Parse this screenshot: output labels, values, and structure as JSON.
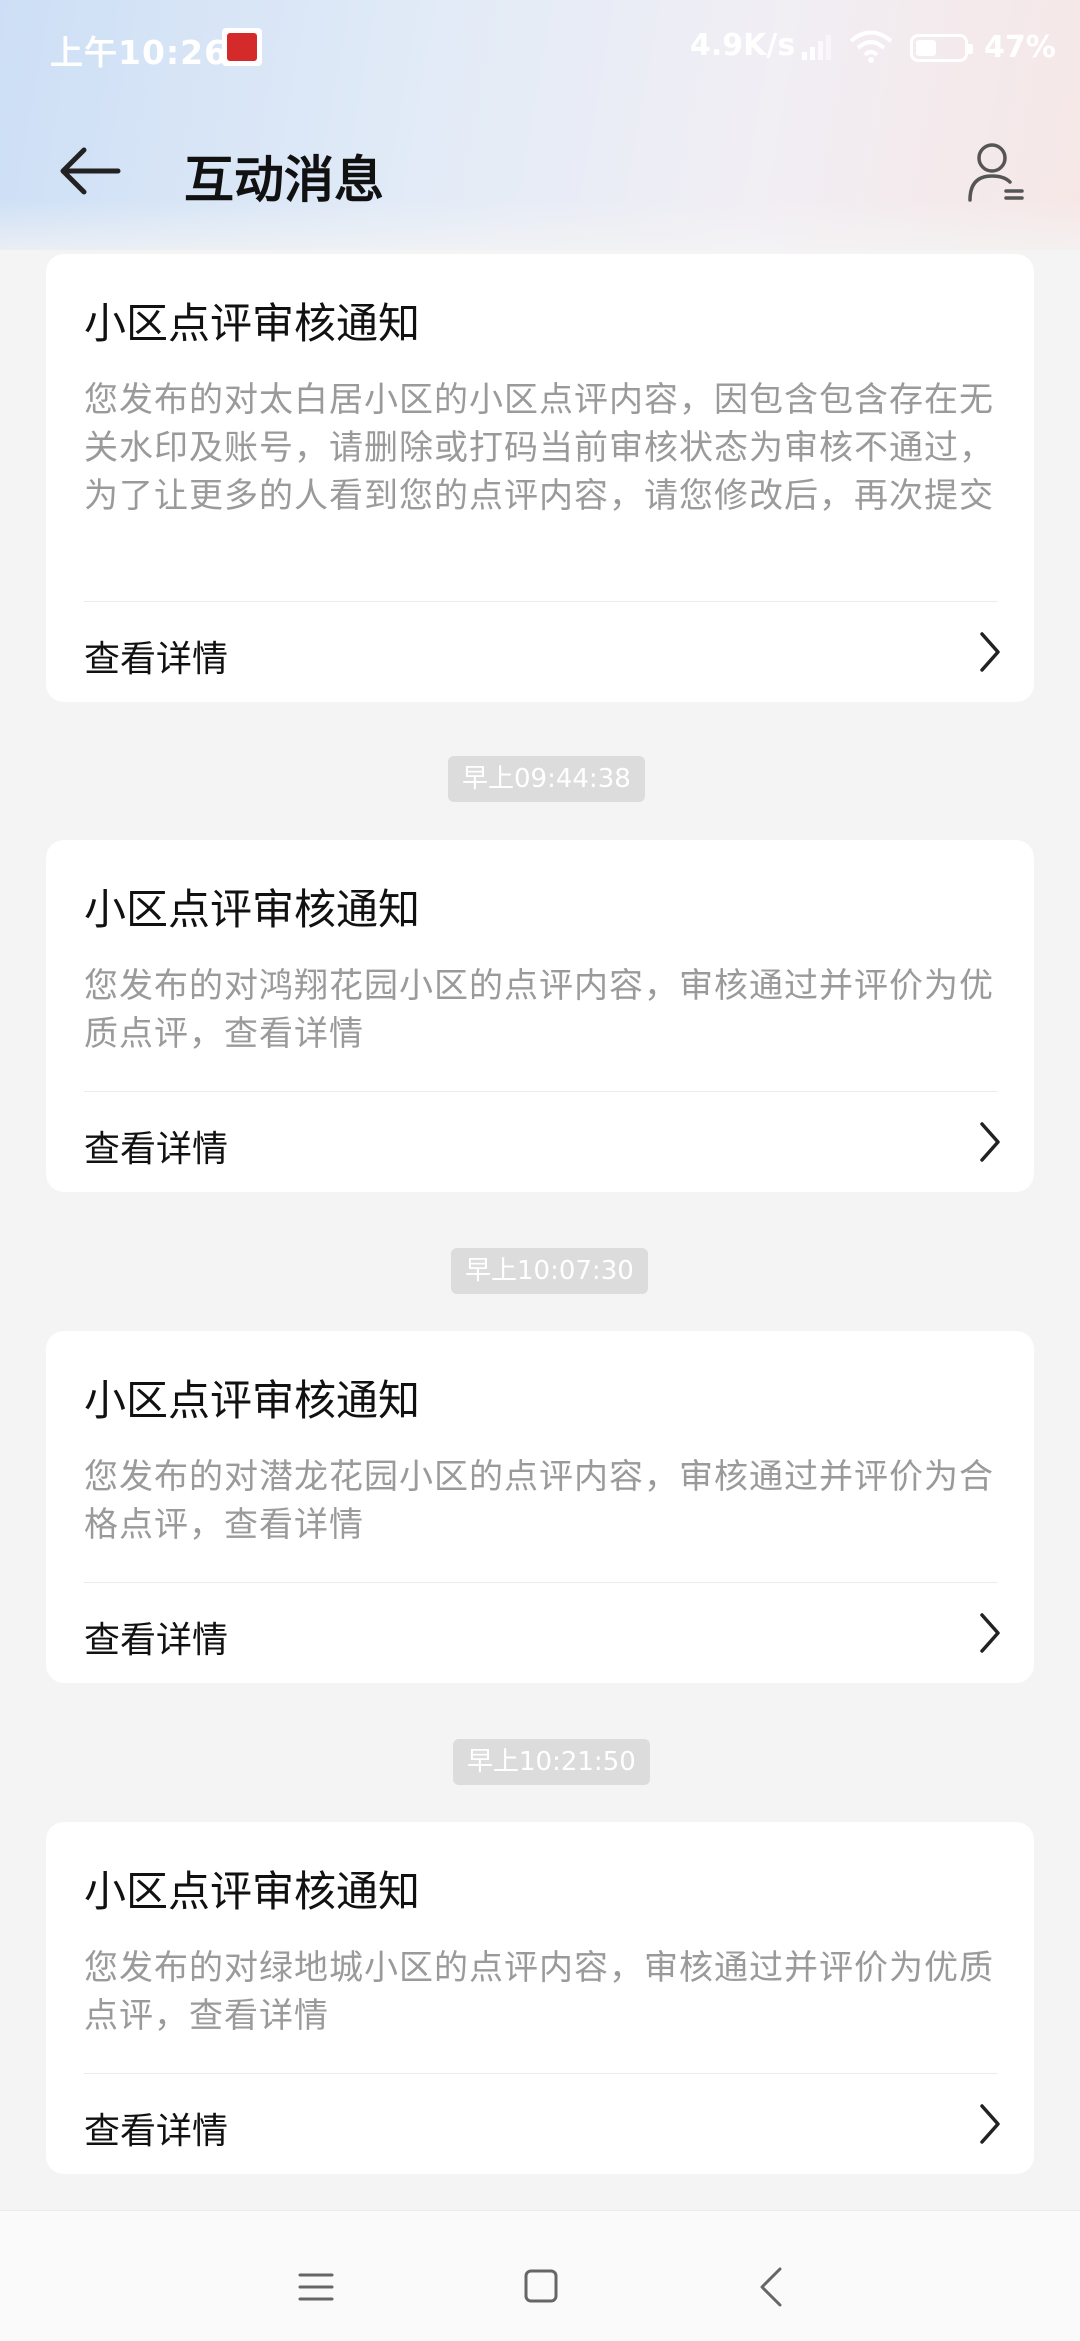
{
  "status_bar": {
    "time": "上午10:26",
    "network_speed": "4.9K/s",
    "battery": "47%"
  },
  "header": {
    "title": "互动消息",
    "back_icon": "back-arrow-icon",
    "profile_icon": "user-list-icon"
  },
  "messages": [
    {
      "title": "小区点评审核通知",
      "body": "您发布的对太白居小区的小区点评内容，因包含包含存在无关水印及账号，请删除或打码当前审核状态为审核不通过，为了让更多的人看到您的点评内容，请您修改后，再次提交",
      "action": "查看详情"
    },
    {
      "timestamp": "早上09:44:38",
      "title": "小区点评审核通知",
      "body": "您发布的对鸿翔花园小区的点评内容，审核通过并评价为优质点评，查看详情",
      "action": "查看详情"
    },
    {
      "timestamp": "早上10:07:30",
      "title": "小区点评审核通知",
      "body": "您发布的对潜龙花园小区的点评内容，审核通过并评价为合格点评，查看详情",
      "action": "查看详情"
    },
    {
      "timestamp": "早上10:21:50",
      "title": "小区点评审核通知",
      "body": "您发布的对绿地城小区的点评内容，审核通过并评价为优质点评，查看详情",
      "action": "查看详情"
    }
  ],
  "nav_bar": {
    "menu_icon": "menu-icon",
    "home_icon": "home-square-icon",
    "back_icon": "back-triangle-icon"
  },
  "colors": {
    "background": "#f4f4f4",
    "card": "#ffffff",
    "body_text": "#9a9a9a",
    "timestamp_bg": "#dcdcdc"
  }
}
